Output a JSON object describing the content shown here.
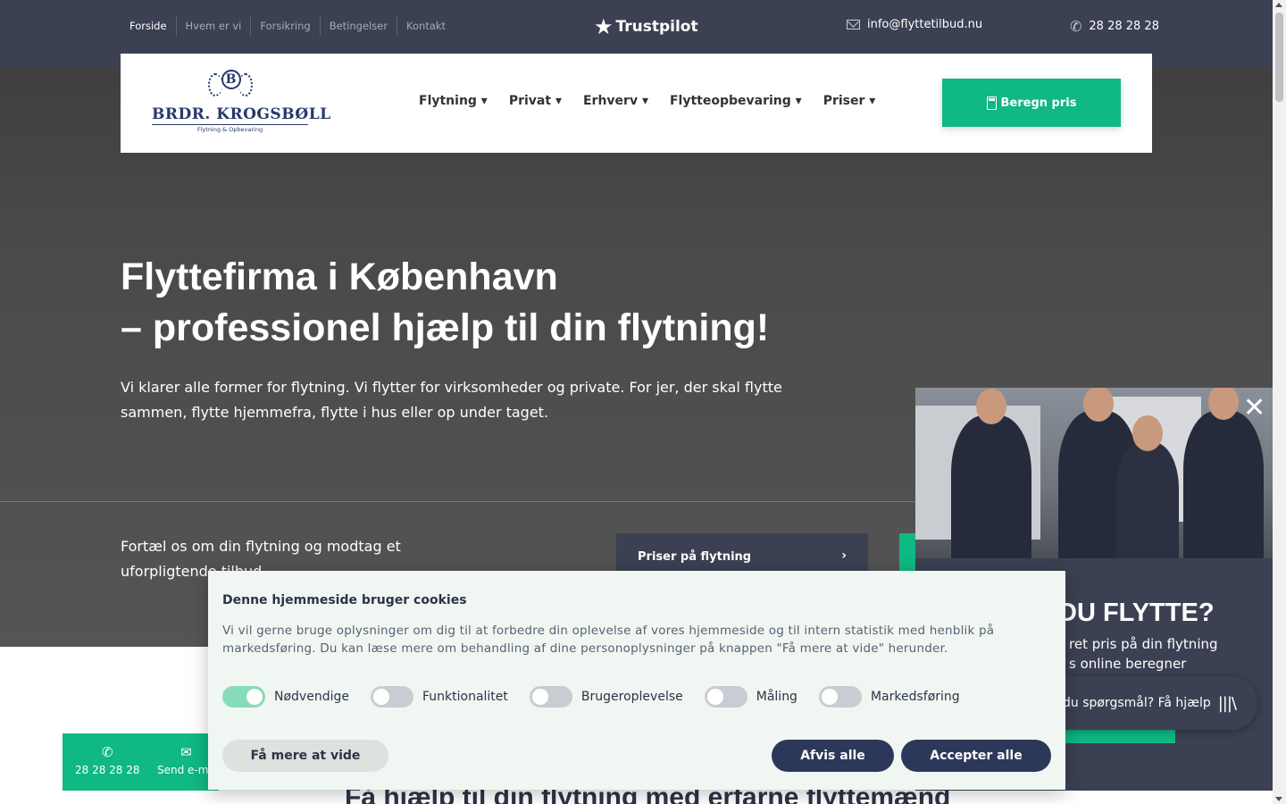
{
  "topbar": {
    "links": [
      "Forside",
      "Hvem er vi",
      "Forsikring",
      "Betingelser",
      "Kontakt"
    ],
    "trustpilot": "Trustpilot",
    "email": "info@flyttetilbud.nu",
    "phone": "28 28 28 28"
  },
  "logo": {
    "monogram": "B",
    "name": "BRDR. KROGSBØLL",
    "tagline": "Flytning & Opbevaring"
  },
  "nav": {
    "items": [
      "Flytning ▾",
      "Privat ▾",
      "Erhverv ▾",
      "Flytteopbevaring ▾",
      "Priser ▾"
    ],
    "cta": "Beregn pris"
  },
  "hero": {
    "title_line1": "Flyttefirma i København",
    "title_line2": "– professionel hjælp til din flytning!",
    "text": "Vi klarer alle former for flytning. Vi flytter for virksomheder og private. For jer, der skal flytte sammen, flytte hjemmefra, flytte i hus eller op under taget.",
    "tell_us": "Fortæl os om din flytning og modtag et uforpligtende tilbud",
    "price_button": "Priser på flytning"
  },
  "lower": {
    "heading": "Få hjælp til din flytning med erfarne flyttemænd"
  },
  "popup": {
    "heading": "DU FLYTTE?",
    "text_line1": "ret pris på din flytning",
    "text_line2": "s online beregner"
  },
  "chat": {
    "label": "du spørgsmål? Få hjælp",
    "icon": "|||\\"
  },
  "cookie": {
    "title": "Denne hjemmeside bruger cookies",
    "text": "Vi vil gerne bruge oplysninger om dig til at forbedre din oplevelse af vores hjemmeside og til intern statistik med henblik på markedsføring. Du kan læse mere om behandling af dine personoplysninger på knappen \"Få mere at vide\" herunder.",
    "toggles": [
      {
        "label": "Nødvendige",
        "on": true
      },
      {
        "label": "Funktionalitet",
        "on": false
      },
      {
        "label": "Brugeroplevelse",
        "on": false
      },
      {
        "label": "Måling",
        "on": false
      },
      {
        "label": "Markedsføring",
        "on": false
      }
    ],
    "more_button": "Få mere at vide",
    "reject_button": "Afvis alle",
    "accept_button": "Accepter alle"
  },
  "contact_widget": {
    "call_label": "28 28 28 28",
    "mail_label": "Send e-ma"
  },
  "colors": {
    "navy": "#3b4152",
    "green": "#10b883",
    "button_dark": "#2d3759"
  }
}
